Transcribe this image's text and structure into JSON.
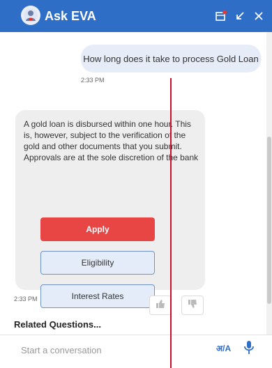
{
  "header": {
    "title": "Ask EVA",
    "colors": {
      "bg": "#2f6ec7"
    }
  },
  "chat": {
    "user_message": "How long does it take to process Gold Loan",
    "user_time": "2:33 PM",
    "bot_message": "A gold loan is disbursed within one hour. This is, however, subject to the verification of the gold and other documents that you submit. Approvals are at the sole discretion of the bank",
    "buttons": [
      {
        "label": "Apply"
      },
      {
        "label": "Eligibility"
      },
      {
        "label": "Interest Rates"
      }
    ],
    "bot_time": "2:33 PM",
    "related_questions_label": "Related Questions..."
  },
  "composer": {
    "placeholder": "Start a conversation",
    "language_toggle": "अ/A"
  }
}
